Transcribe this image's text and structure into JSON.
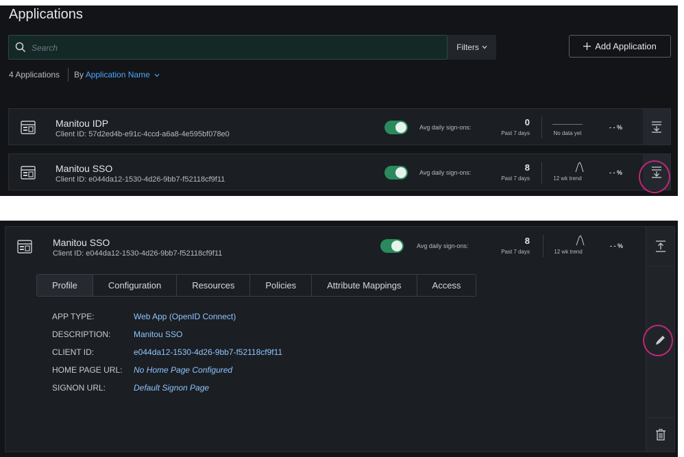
{
  "page": {
    "title": "Applications"
  },
  "search": {
    "placeholder": "Search"
  },
  "filters": {
    "label": "Filters"
  },
  "add_button": {
    "label": "Add Application"
  },
  "summary": {
    "count": "4 Applications",
    "sort_prefix": "By",
    "sort_value": "Application Name"
  },
  "apps": [
    {
      "name": "Manitou IDP",
      "client_id": "Client ID: 57d2ed4b-e91c-4ccd-a6a8-4e595bf078e0",
      "enabled": true,
      "signons_label": "Avg daily sign-ons:",
      "signons_value": "0",
      "signons_period": "Past 7 days",
      "trend_label": "No data yet",
      "pct": "- - %"
    },
    {
      "name": "Manitou SSO",
      "client_id": "Client ID: e044da12-1530-4d26-9bb7-f52118cf9f11",
      "enabled": true,
      "signons_label": "Avg daily sign-ons:",
      "signons_value": "8",
      "signons_period": "Past 7 days",
      "trend_label": "12 wk trend",
      "pct": "- - %"
    }
  ],
  "detail": {
    "name": "Manitou SSO",
    "client_id": "Client ID: e044da12-1530-4d26-9bb7-f52118cf9f11",
    "signons_label": "Avg daily sign-ons:",
    "signons_value": "8",
    "signons_period": "Past 7 days",
    "trend_label": "12 wk trend",
    "pct": "- - %",
    "tabs": [
      "Profile",
      "Configuration",
      "Resources",
      "Policies",
      "Attribute Mappings",
      "Access"
    ],
    "active_tab": "Profile",
    "fields": [
      {
        "label": "APP TYPE:",
        "value": "Web App (OpenID Connect)"
      },
      {
        "label": "DESCRIPTION:",
        "value": "Manitou SSO"
      },
      {
        "label": "CLIENT ID:",
        "value": "e044da12-1530-4d26-9bb7-f52118cf9f11"
      },
      {
        "label": "HOME PAGE URL:",
        "value": "No Home Page Configured"
      },
      {
        "label": "SIGNON URL:",
        "value": "Default Signon Page"
      }
    ]
  },
  "icons": {
    "search": "search-icon",
    "chevron": "chevron-down-icon",
    "plus": "plus-icon",
    "app": "application-icon",
    "expand": "expand-icon",
    "collapse": "collapse-icon",
    "edit": "pencil-icon",
    "delete": "trash-icon"
  },
  "colors": {
    "accent": "#4da7ff",
    "toggle_on": "#2a8a5e",
    "annotation": "#c0277a",
    "background": "#121417"
  }
}
